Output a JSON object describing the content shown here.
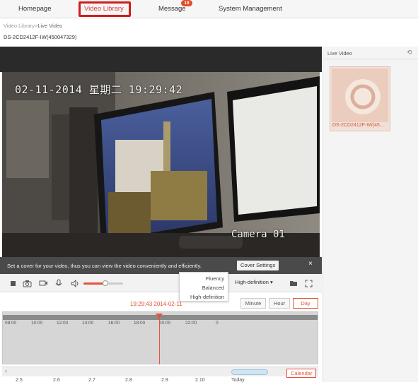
{
  "nav": {
    "items": [
      {
        "label": "Homepage"
      },
      {
        "label": "Video Library"
      },
      {
        "label": "Message"
      },
      {
        "label": "System Management"
      }
    ],
    "message_badge": "19"
  },
  "breadcrumb": {
    "parent": "Video Library",
    "sep": ">",
    "current": "Live Video"
  },
  "device_title": "DS-2CD2412F-IW(450047329)",
  "video": {
    "osd_date": "02-11-2014 星期二 19:29:42",
    "osd_camera": "Camera 01"
  },
  "cover_bar": {
    "text": "Set a cover for your video, thus you can view the video conveniently and efficiently.",
    "button": "Cover Settings",
    "close": "×"
  },
  "controls": {
    "volume_level": 0.55,
    "quality": "High-definition",
    "quality_arrow": "▾",
    "quality_options": [
      "Fluency",
      "Balanced",
      "High-definition"
    ]
  },
  "playback": {
    "timestamp": "19:29:43 2014-02-11",
    "ranges": [
      "Minute",
      "Hour",
      "Day"
    ],
    "active_range": "Day"
  },
  "timeline": {
    "ticks": [
      "08:00",
      "10:00",
      "12:00",
      "14:00",
      "16:00",
      "18:00",
      "20:00",
      "22:00",
      "0"
    ]
  },
  "calendar": {
    "prev": "‹",
    "button": "Calendar",
    "dates": [
      "2.5",
      "2.6",
      "2.7",
      "2.8",
      "2.9",
      "2.10",
      "Today"
    ]
  },
  "right_panel": {
    "title": "Live Video",
    "card_label": "DS-2CD2412F-IW(45..."
  },
  "colors": {
    "accent": "#e4533b",
    "nav_highlight": "#d01c1c"
  }
}
